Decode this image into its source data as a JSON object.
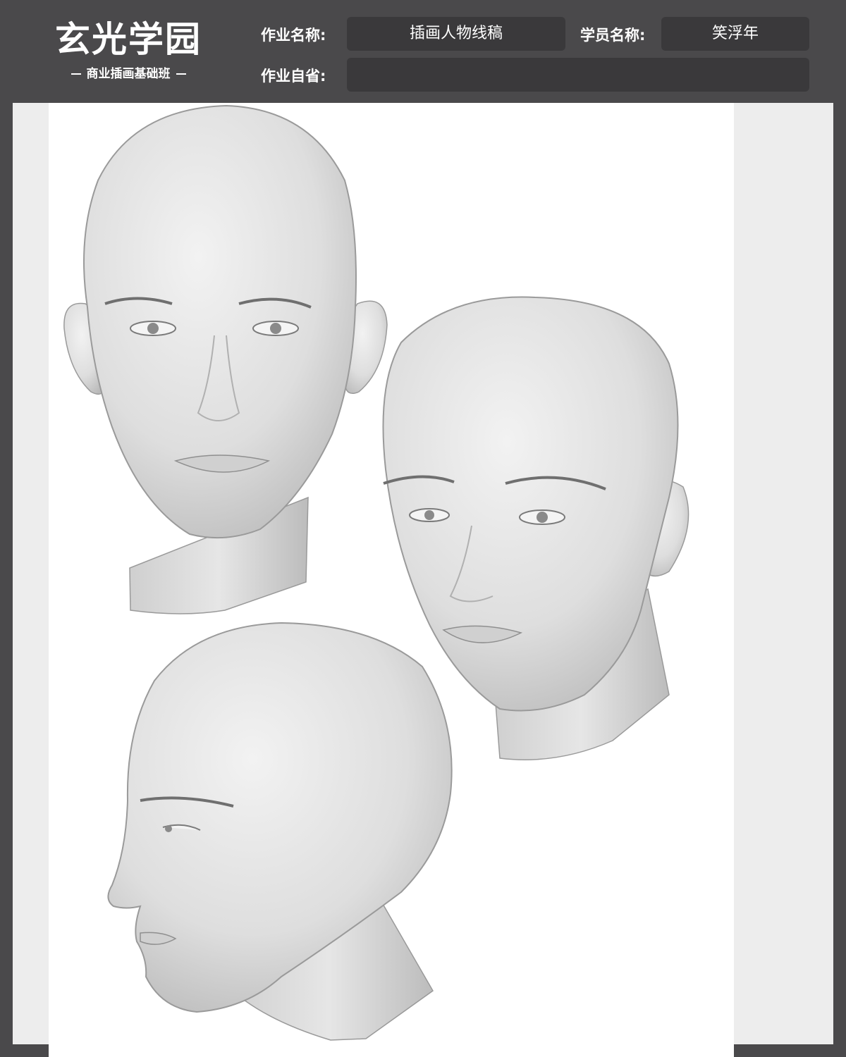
{
  "brand": {
    "name": "玄光学园",
    "subtitle": "商业插画基础班"
  },
  "form": {
    "assignment_name_label": "作业名称:",
    "assignment_name_value": "插画人物线稿",
    "student_name_label": "学员名称:",
    "student_name_value": "笑浮年",
    "self_review_label": "作业自省:",
    "self_review_value": ""
  },
  "colors": {
    "header": "#4a494b",
    "field": "#3a393b",
    "canvas": "#ededed",
    "paper": "#ffffff",
    "skin_light": "#eaeaea",
    "skin_shadow": "#bdbdbd",
    "line": "#9a9a9a"
  },
  "artwork": {
    "subjects": [
      "front-view-head",
      "three-quarter-view-head",
      "profile-view-head"
    ]
  }
}
